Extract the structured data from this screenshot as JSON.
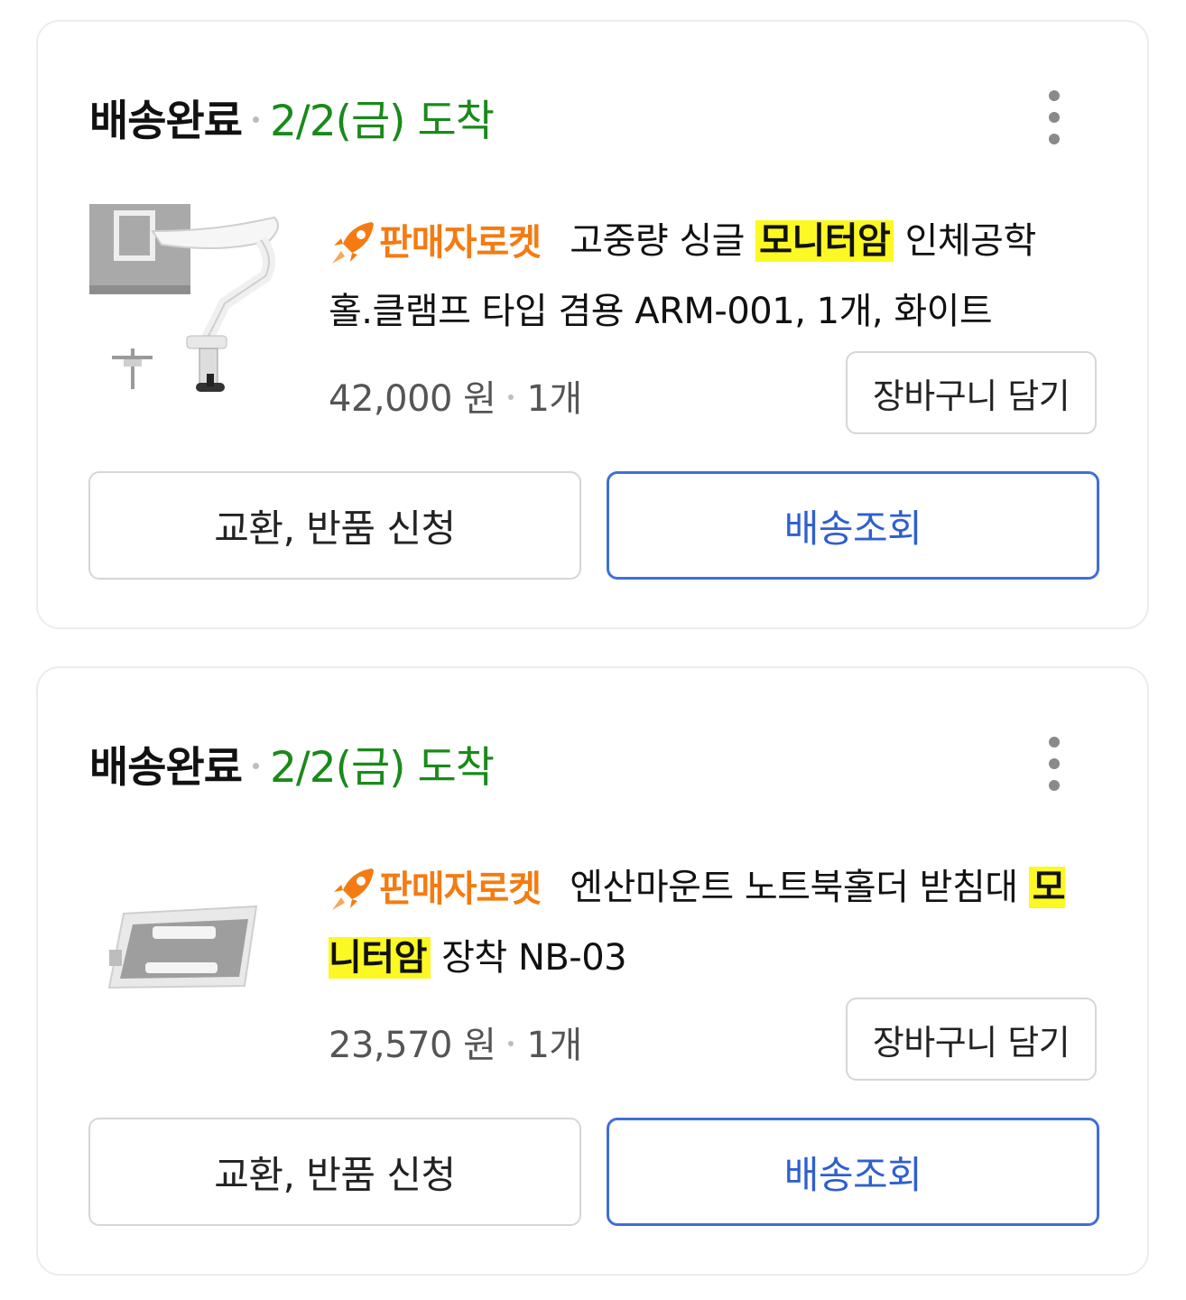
{
  "orders": [
    {
      "status": "배송완료",
      "arrival": "2/2(금) 도착",
      "badge": "판매자로켓",
      "title_pre": "고중량 싱글",
      "title_highlight": "모니터암",
      "title_post": "인체공학 홀.클램프 타입 겸용 ARM-001, 1개, 화이트",
      "price": "42,000 원",
      "qty": "1개",
      "cart_label": "장바구니 담기",
      "exchange_label": "교환, 반품 신청",
      "track_label": "배송조회",
      "image_icon": "monitor-arm-product-image"
    },
    {
      "status": "배송완료",
      "arrival": "2/2(금) 도착",
      "badge": "판매자로켓",
      "title_pre": "엔산마운트 노트북홀더 받침대",
      "title_highlight": "모니터암",
      "title_post": "장착 NB-03",
      "price": "23,570 원",
      "qty": "1개",
      "cart_label": "장바구니 담기",
      "exchange_label": "교환, 반품 신청",
      "track_label": "배송조회",
      "image_icon": "laptop-tray-product-image"
    }
  ],
  "colors": {
    "arrival_green": "#1a8a1a",
    "badge_orange": "#f47b12",
    "highlight_yellow": "#fbf823",
    "track_blue": "#3f6fd8"
  }
}
